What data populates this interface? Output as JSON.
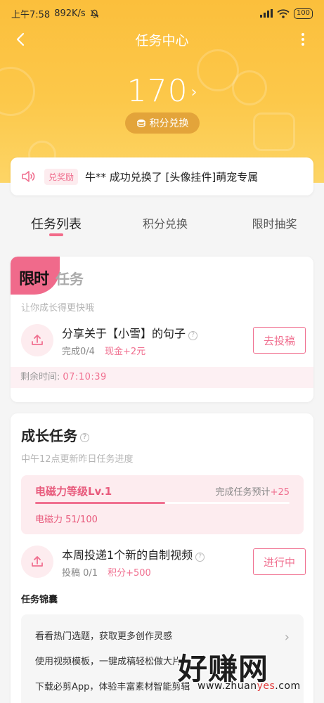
{
  "status_bar": {
    "time": "上午7:58",
    "network_speed": "892K/s",
    "battery": "100"
  },
  "nav": {
    "title": "任务中心"
  },
  "points": {
    "value": "170",
    "exchange_label": "积分兑换"
  },
  "notice": {
    "badge": "兑奖励",
    "text": "牛** 成功兑换了 [头像挂件]萌宠专属"
  },
  "tabs": [
    {
      "label": "任务列表",
      "active": true
    },
    {
      "label": "积分兑换",
      "active": false
    },
    {
      "label": "限时抽奖",
      "active": false
    }
  ],
  "limited_task": {
    "badge": "限时",
    "title_rest": "任务",
    "subtitle": "让你成长得更快哦",
    "task": {
      "name": "分享关于【小雪】的句子",
      "progress": "完成0/4",
      "reward": "现金+2元",
      "button": "去投稿"
    },
    "countdown_label": "剩余时间:",
    "countdown_value": "07:10:39"
  },
  "growth": {
    "title": "成长任务",
    "subtitle": "中午12点更新昨日任务进度",
    "level": {
      "name": "电磁力等级Lv.1",
      "prediction_label": "完成任务预计",
      "prediction_value": "+25",
      "progress_text": "电磁力 51/100",
      "progress_fraction": 0.51
    },
    "task": {
      "name": "本周投递1个新的自制视频",
      "progress": "投稿 0/1",
      "reward": "积分+500",
      "button": "进行中"
    },
    "kit_title": "任务锦囊",
    "kit_items": [
      "看看热门选题，获取更多创作灵感",
      "使用视频模板，一键成稿轻松做大片",
      "下载必剪App，体验丰富素材智能剪辑"
    ]
  },
  "watermark": {
    "main": "好赚网",
    "url_prefix": "www.zhuan",
    "url_accent": "yes",
    "url_suffix": ".com"
  },
  "colors": {
    "header": "#fbbf3c",
    "accent_pink": "#f07090",
    "pill": "#e3a43a"
  },
  "icons": [
    "back-arrow-icon",
    "more-icon",
    "coin-icon",
    "speaker-icon",
    "upload-icon",
    "help-icon",
    "chevron-right-icon"
  ]
}
